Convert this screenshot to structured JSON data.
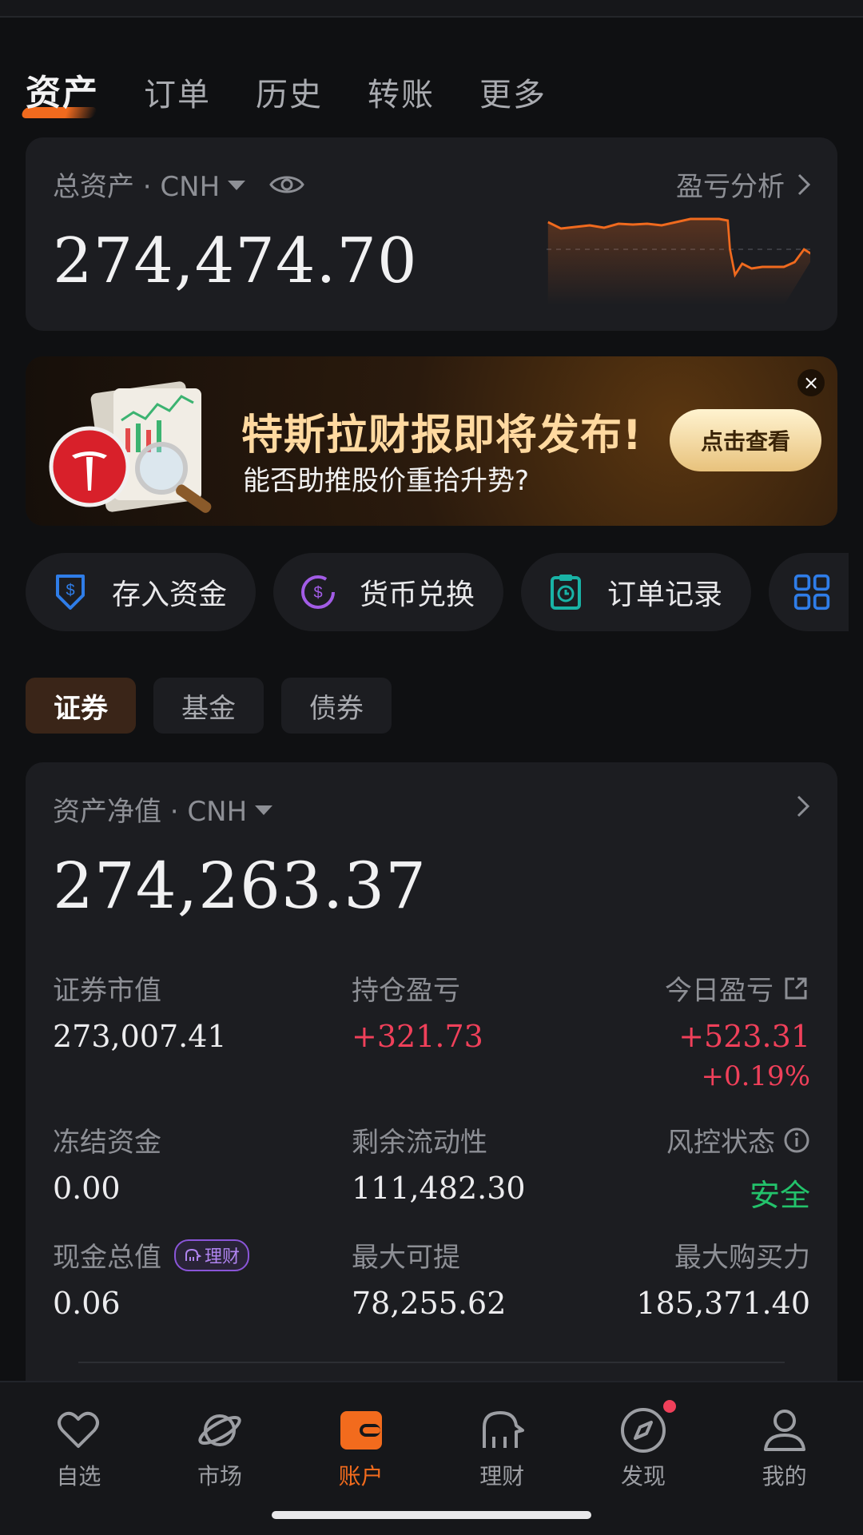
{
  "top_tabs": [
    "资产",
    "订单",
    "历史",
    "转账",
    "更多"
  ],
  "total": {
    "label": "总资产 · CNH",
    "value": "274,474.70",
    "pnl_link": "盈亏分析"
  },
  "banner": {
    "title": "特斯拉财报即将发布!",
    "subtitle": "能否助推股价重拾升势?",
    "button": "点击查看",
    "close": "×"
  },
  "quick_actions": [
    "存入资金",
    "货币兑换",
    "订单记录"
  ],
  "segments": [
    "证券",
    "基金",
    "债券"
  ],
  "net": {
    "label": "资产净值 · CNH",
    "value": "274,263.37",
    "cells": {
      "market_value": {
        "label": "证券市值",
        "value": "273,007.41"
      },
      "position_pnl": {
        "label": "持仓盈亏",
        "value": "+321.73"
      },
      "today_pnl": {
        "label": "今日盈亏",
        "value": "+523.31",
        "pct": "+0.19%"
      },
      "frozen": {
        "label": "冻结资金",
        "value": "0.00"
      },
      "liquidity": {
        "label": "剩余流动性",
        "value": "111,482.30"
      },
      "risk": {
        "label": "风控状态",
        "value": "安全"
      },
      "cash": {
        "label": "现金总值",
        "tag": "理财",
        "value": "0.06"
      },
      "max_withdraw": {
        "label": "最大可提",
        "value": "78,255.62"
      },
      "max_buy": {
        "label": "最大购买力",
        "value": "185,371.40"
      }
    }
  },
  "bottom_nav": [
    "自选",
    "市场",
    "账户",
    "理财",
    "发现",
    "我的"
  ],
  "colors": {
    "accent": "#f26b1d",
    "up": "#f0405a",
    "safe": "#23c26b"
  }
}
